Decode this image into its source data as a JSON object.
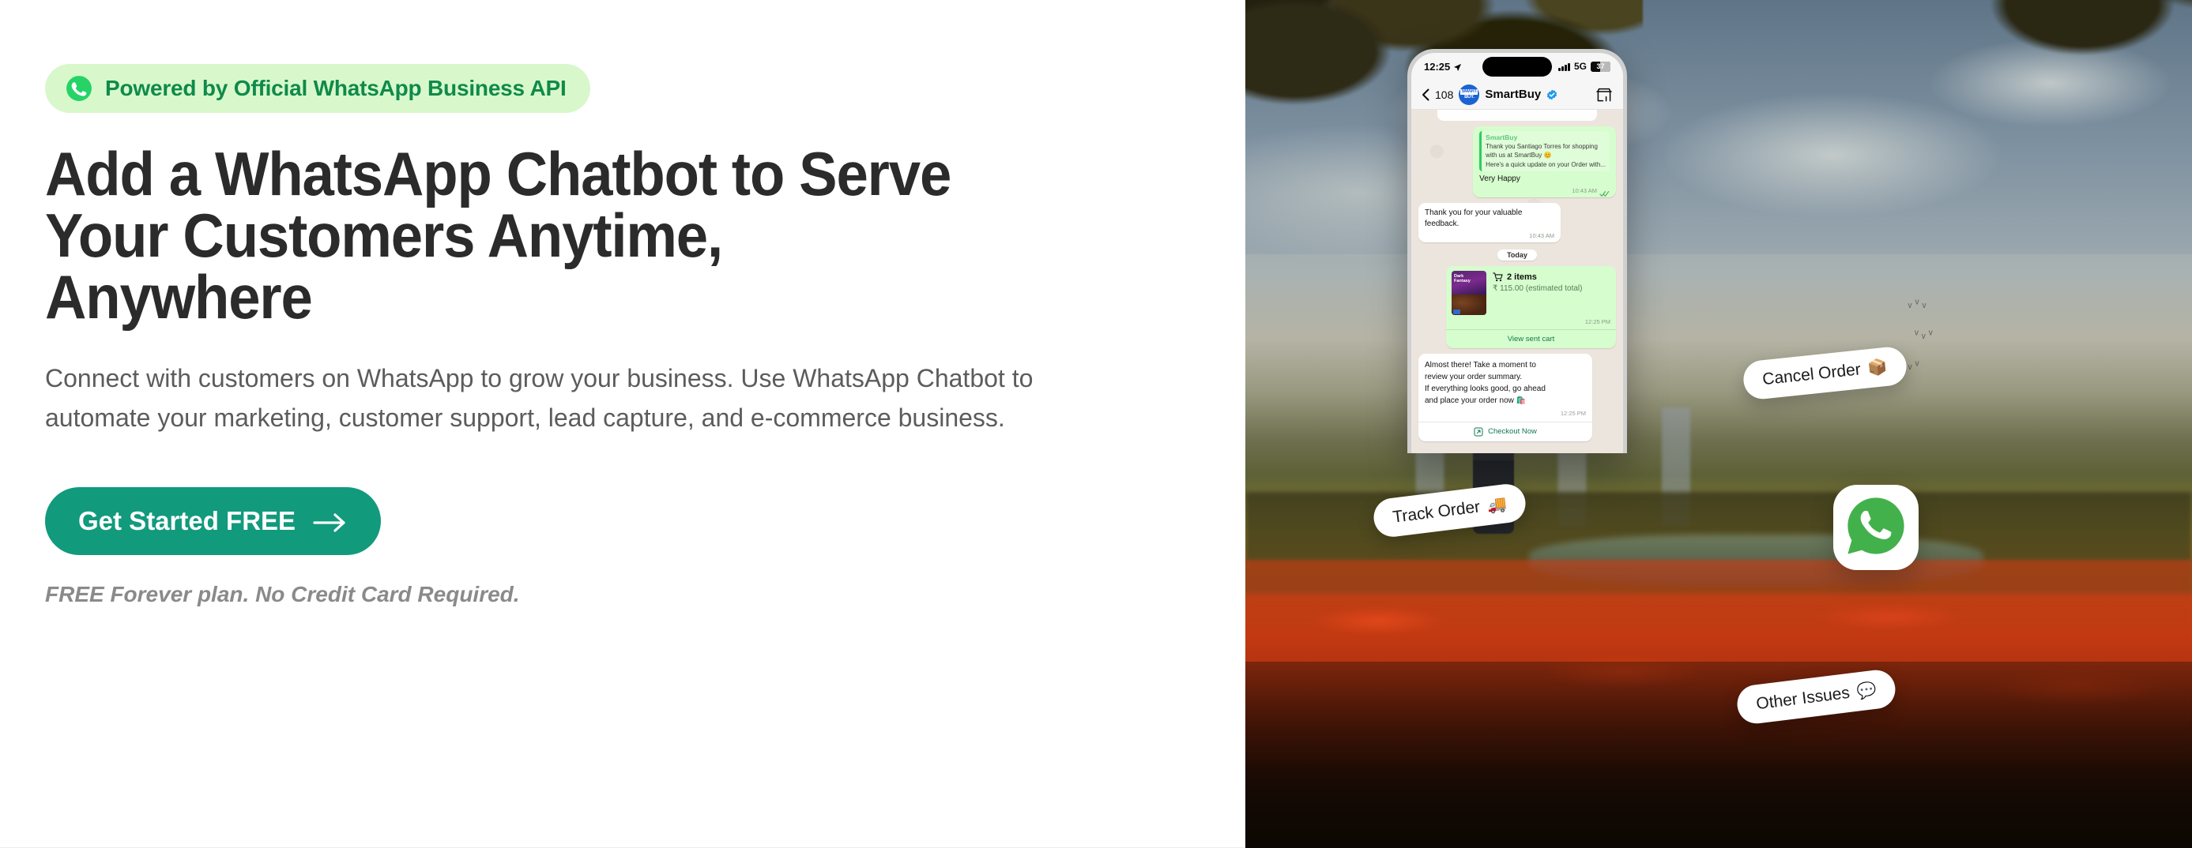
{
  "hero": {
    "badge": {
      "label": "Powered by Official WhatsApp Business API",
      "icon": "whatsapp-icon",
      "bg": "#d8f8cc",
      "text_color": "#0f8a4a"
    },
    "headline_lines": [
      "Add a WhatsApp Chatbot to Serve",
      "Your Customers Anytime,",
      "Anywhere"
    ],
    "subtext": "Connect with customers on WhatsApp to grow your business. Use WhatsApp Chatbot to automate your marketing, customer support, lead capture, and e-commerce business.",
    "cta": {
      "label": "Get Started FREE",
      "icon": "arrow-right-icon",
      "bg": "#129a7d",
      "text_color": "#ffffff"
    },
    "fineprint": "FREE Forever plan. No Credit Card Required."
  },
  "phone": {
    "status_bar": {
      "time": "12:25",
      "location_icon": "location-arrow-icon",
      "network": "5G",
      "battery": "37",
      "signal_icon": "signal-bars-icon"
    },
    "chat_header": {
      "back_icon": "chevron-left-icon",
      "unread_count": "108",
      "avatar_line1": "SMART",
      "avatar_line2": "BUY.",
      "name": "SmartBuy",
      "verified_icon": "verified-badge-icon",
      "store_icon": "storefront-icon"
    },
    "messages": [
      {
        "id": "reply-very-happy",
        "direction": "out",
        "quote_name": "SmartBuy",
        "quote_lines": [
          "Thank you Santiago Torres for shopping",
          "with us at SmartBuy 😊",
          "Here's a quick update on your Order with..."
        ],
        "text": "Very Happy",
        "time": "10:43 AM",
        "ticks_icon": "double-check-icon"
      },
      {
        "id": "feedback-thanks",
        "direction": "in",
        "text": "Thank you for your valuable feedback.",
        "time": "10:43 AM"
      }
    ],
    "day_divider": "Today",
    "cart_card": {
      "product_label_line1": "Dark",
      "product_label_line2": "Fantasy",
      "cart_icon": "shopping-cart-icon",
      "items": "2 items",
      "total": "₹ 115.00 (estimated total)",
      "time": "12:25 PM",
      "button": "View sent cart"
    },
    "summary_card": {
      "lines": [
        "Almost there! Take a moment to",
        "review your order summary.",
        "If everything looks good, go ahead",
        "and place your order now 🛍️"
      ],
      "time": "12:25 PM",
      "button": "Checkout Now",
      "button_icon": "external-link-icon"
    }
  },
  "chips": [
    {
      "id": "cancel-order",
      "label": "Cancel Order",
      "emoji": "📦"
    },
    {
      "id": "track-order",
      "label": "Track Order",
      "emoji": "🚚"
    },
    {
      "id": "other-issues",
      "label": "Other Issues",
      "emoji": "💬"
    }
  ],
  "floating_logo": {
    "icon": "whatsapp-logo-icon",
    "color": "#43b14b"
  }
}
